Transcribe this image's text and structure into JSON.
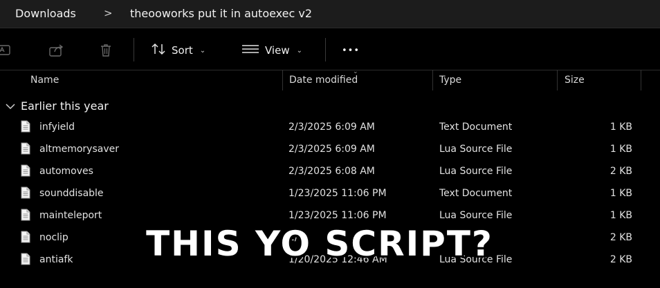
{
  "breadcrumb": {
    "items": [
      "Downloads",
      "theooworks put it in autoexec v2"
    ],
    "separator": ">"
  },
  "toolbar": {
    "sort_label": "Sort",
    "view_label": "View",
    "more_label": "•••"
  },
  "columns": {
    "name": "Name",
    "date": "Date modified",
    "type": "Type",
    "size": "Size"
  },
  "group": {
    "label": "Earlier this year"
  },
  "files": [
    {
      "name": "infyield",
      "date": "2/3/2025 6:09 AM",
      "type": "Text Document",
      "size": "1 KB"
    },
    {
      "name": "altmemorysaver",
      "date": "2/3/2025 6:09 AM",
      "type": "Lua Source File",
      "size": "1 KB"
    },
    {
      "name": "automoves",
      "date": "2/3/2025 6:08 AM",
      "type": "Lua Source File",
      "size": "2 KB"
    },
    {
      "name": "sounddisable",
      "date": "1/23/2025 11:06 PM",
      "type": "Text Document",
      "size": "1 KB"
    },
    {
      "name": "mainteleport",
      "date": "1/23/2025 11:06 PM",
      "type": "Lua Source File",
      "size": "1 KB"
    },
    {
      "name": "noclip",
      "date": "1/2",
      "type": "",
      "size": "2 KB"
    },
    {
      "name": "antiafk",
      "date": "1/20/2025 12:46 AM",
      "type": "Lua Source File",
      "size": "2 KB"
    }
  ],
  "caption": "THIS YO SCRIPT?",
  "colors": {
    "background": "#000000",
    "breadcrumb_bg": "#1c1c1c",
    "text": "#e6e6e6"
  }
}
